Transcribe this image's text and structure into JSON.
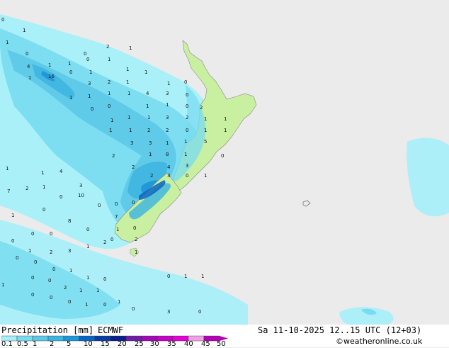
{
  "footer": {
    "title": "Precipitation [mm]",
    "model": "ECMWF",
    "datetime": "Sa 11-10-2025 12..15 UTC (12+03)",
    "credit": "©weatheronline.co.uk"
  },
  "colorbar": {
    "ticks": [
      "0.1",
      "0.5",
      "1",
      "2",
      "5",
      "10",
      "15",
      "20",
      "25",
      "30",
      "35",
      "40",
      "45",
      "50"
    ],
    "colors": [
      "#a6f0fa",
      "#78dcf0",
      "#5ac8e6",
      "#3cb4e1",
      "#1e96d7",
      "#0a64c3",
      "#0a3ca5",
      "#0a1e8c",
      "#6e1ea5",
      "#a00ab4",
      "#c800c8",
      "#e600d2",
      "#f0a0e6",
      "#b400b4"
    ]
  },
  "map": {
    "land_color": "#c8f0a0",
    "sea_color": "#ebebeb",
    "labels": [
      "0",
      "1",
      "1",
      "0",
      "0",
      "2",
      "1",
      "0",
      "4",
      "1",
      "1",
      "1",
      "1",
      "0",
      "16",
      "1",
      "1",
      "3",
      "2",
      "1",
      "1",
      "1",
      "0",
      "1",
      "1",
      "1",
      "1",
      "0",
      "0",
      "4",
      "3",
      "0",
      "1",
      "1",
      "1",
      "1",
      "0",
      "2",
      "1",
      "1",
      "1",
      "3",
      "2",
      "1",
      "1",
      "3",
      "2",
      "2",
      "0",
      "1",
      "1",
      "2",
      "3",
      "1",
      "1",
      "5",
      "0",
      "8",
      "1",
      "1",
      "4",
      "3",
      "2",
      "2",
      "3",
      "0",
      "1",
      "1",
      "1",
      "4",
      "7",
      "2",
      "1",
      "0",
      "10",
      "0",
      "0",
      "0",
      "3",
      "0",
      "1",
      "0",
      "0",
      "0",
      "1",
      "2",
      "0",
      "7",
      "8",
      "0",
      "0",
      "1",
      "2",
      "3",
      "1",
      "2",
      "1",
      "0",
      "0",
      "0",
      "1",
      "1",
      "0",
      "0",
      "0",
      "2",
      "1",
      "1",
      "1",
      "0",
      "0",
      "0",
      "1",
      "0",
      "1",
      "0",
      "0",
      "1",
      "1",
      "3",
      "0"
    ]
  }
}
